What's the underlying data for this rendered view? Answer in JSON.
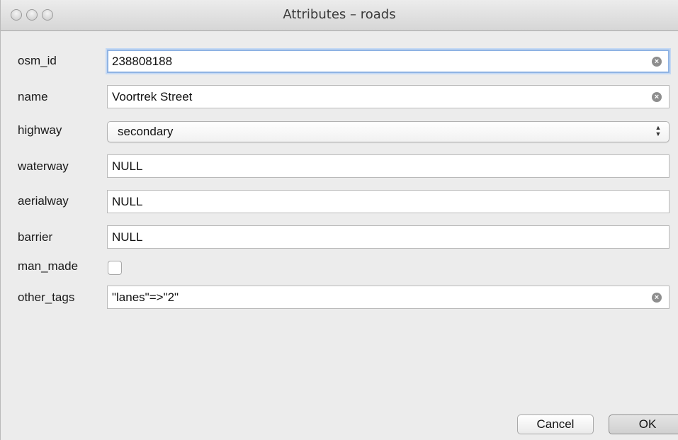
{
  "window": {
    "title": "Attributes – roads"
  },
  "fields": {
    "osm_id": {
      "label": "osm_id",
      "value": "238808188"
    },
    "name": {
      "label": "name",
      "value": "Voortrek Street"
    },
    "highway": {
      "label": "highway",
      "value": "secondary"
    },
    "waterway": {
      "label": "waterway",
      "value": "NULL"
    },
    "aerialway": {
      "label": "aerialway",
      "value": "NULL"
    },
    "barrier": {
      "label": "barrier",
      "value": "NULL"
    },
    "man_made": {
      "label": "man_made",
      "checked": false
    },
    "other_tags": {
      "label": "other_tags",
      "value": "\"lanes\"=>\"2\""
    }
  },
  "buttons": {
    "cancel": "Cancel",
    "ok": "OK"
  },
  "icons": {
    "clear": "clear-icon",
    "select_arrows": "updown-arrows-icon"
  },
  "colors": {
    "focus_ring": "#8fb3e3",
    "window_bg": "#ececec"
  }
}
